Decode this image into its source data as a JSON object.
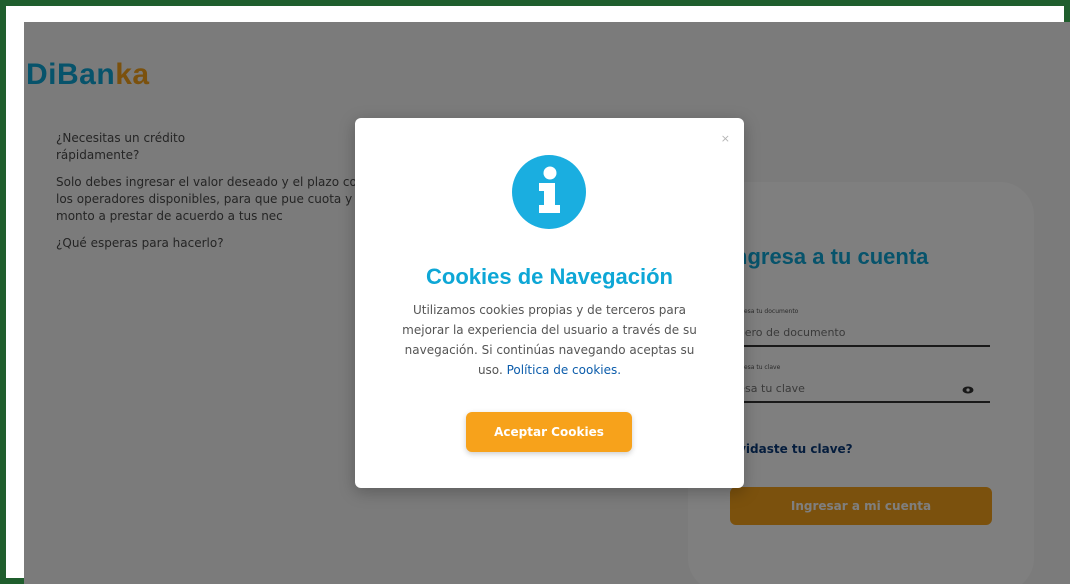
{
  "brand": {
    "logo_main": "DiBan",
    "logo_accent": "ka",
    "blue": "#0ea7d6",
    "orange": "#f7a21b"
  },
  "promo": {
    "q1": "¿Necesitas un crédito rápidamente?",
    "body": "Solo debes ingresar el valor deseado y el plazo con los operadores disponibles, para que pue cuota y monto a prestar de acuerdo a tus nec",
    "q2": "¿Qué esperas para hacerlo?"
  },
  "login": {
    "title": "ngresa a tu cuenta",
    "doc_label": "ngresa tu documento",
    "doc_placeholder": "mero de documento",
    "pwd_label": "ngresa tu clave",
    "pwd_placeholder": "resa tu clave",
    "forgot": "lvidaste tu clave?",
    "submit": "Ingresar a mi cuenta"
  },
  "modal": {
    "close": "×",
    "icon": "info-icon",
    "title": "Cookies de Navegación",
    "text": "Utilizamos cookies propias y de terceros para mejorar la experiencia del usuario a través de su navegación. Si continúas navegando aceptas su uso.",
    "link": "Política de cookies.",
    "accept": "Aceptar Cookies"
  }
}
